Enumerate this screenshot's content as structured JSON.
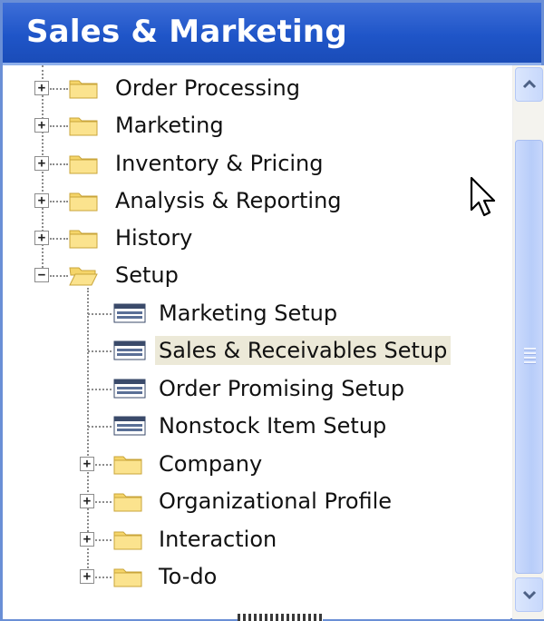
{
  "window": {
    "title": "Sales & Marketing"
  },
  "tree": {
    "items": [
      {
        "label": "Order Processing",
        "type": "folder",
        "expander": "+"
      },
      {
        "label": "Marketing",
        "type": "folder",
        "expander": "+"
      },
      {
        "label": "Inventory & Pricing",
        "type": "folder",
        "expander": "+"
      },
      {
        "label": "Analysis & Reporting",
        "type": "folder",
        "expander": "+"
      },
      {
        "label": "History",
        "type": "folder",
        "expander": "+"
      },
      {
        "label": "Setup",
        "type": "folder-open",
        "expander": "−"
      },
      {
        "label": "Marketing Setup",
        "type": "form"
      },
      {
        "label": "Sales & Receivables Setup",
        "type": "form",
        "selected": true
      },
      {
        "label": "Order Promising Setup",
        "type": "form"
      },
      {
        "label": "Nonstock Item Setup",
        "type": "form"
      },
      {
        "label": "Company",
        "type": "folder",
        "expander": "+"
      },
      {
        "label": "Organizational Profile",
        "type": "folder",
        "expander": "+"
      },
      {
        "label": "Interaction",
        "type": "folder",
        "expander": "+"
      },
      {
        "label": "To-do",
        "type": "folder",
        "expander": "+"
      }
    ]
  },
  "icons": {
    "folder": "folder-icon",
    "folder_open": "folder-open-icon",
    "form": "form-icon",
    "cursor": "mouse-pointer-icon"
  },
  "colors": {
    "title_bar": "#1f55c8",
    "selection": "#ece9d8",
    "folder": "#f5d56a"
  }
}
